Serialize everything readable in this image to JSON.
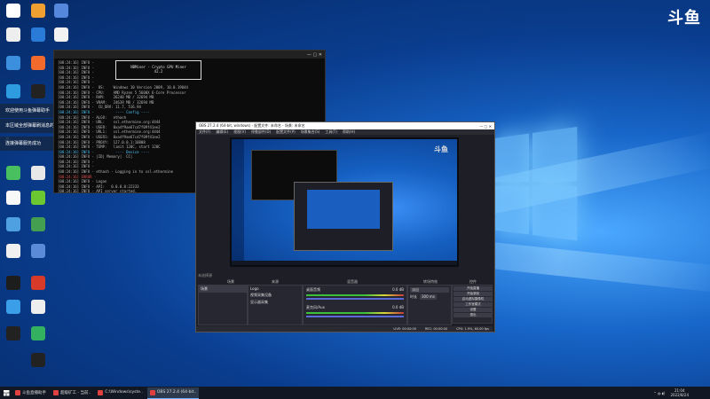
{
  "brand_logo": "斗鱼",
  "desktop_icons": [
    {
      "label": "",
      "color": "#ffffff"
    },
    {
      "label": "",
      "color": "#f0a030"
    },
    {
      "label": "",
      "color": "#5588dd"
    },
    {
      "label": "",
      "color": "#eeeeee"
    },
    {
      "label": "",
      "color": "#2a7ad8"
    },
    {
      "label": "",
      "color": "#f2f2f2"
    },
    {
      "label": "",
      "color": "#3b8fdc"
    },
    {
      "label": "",
      "color": "#f26a2c"
    },
    {
      "label": "",
      "color": "#2e9ae0"
    },
    {
      "label": "",
      "color": "#222222"
    },
    {
      "label": "",
      "color": "#48c060"
    },
    {
      "label": "",
      "color": "#e8e8e8"
    },
    {
      "label": "",
      "color": "#f8f8f8"
    },
    {
      "label": "",
      "color": "#6bc830"
    },
    {
      "label": "",
      "color": "#4fa0e0"
    },
    {
      "label": "",
      "color": "#44a050"
    },
    {
      "label": "",
      "color": "#f0f0f0"
    },
    {
      "label": "",
      "color": "#5a8ad8"
    },
    {
      "label": "",
      "color": "#1d1d1d"
    },
    {
      "label": "",
      "color": "#d83a2a"
    },
    {
      "label": "",
      "color": "#3b9ee8"
    },
    {
      "label": "",
      "color": "#eeeeee"
    },
    {
      "label": "",
      "color": "#222222"
    },
    {
      "label": "",
      "color": "#33b060"
    },
    {
      "label": "",
      "color": "#222222"
    }
  ],
  "toasts": [
    "欢迎使用斗鱼弹幕助手",
    "本区域全部弹幕刷消息的消息",
    "连接弹幕服务成功"
  ],
  "console": {
    "title": "",
    "banner_line1": "NBMiner - Crypto GPU Miner",
    "banner_line2": "42.2",
    "lines": [
      "[08:24:16] INFO - ",
      "[08:24:16] INFO - ",
      "[08:24:16] INFO - ",
      "[08:24:16] INFO - ",
      "[08:24:16] INFO - ",
      "[08:24:16] INFO -  OS:    Windows 10 Version 2009, 10.0.19044",
      "[08:24:16] INFO - CPU:    AMD Ryzen 5 5600X 6-Core Processor",
      "[08:24:16] INFO - RAM:    26240 MB / 32694 MB",
      "[08:24:16] INFO - VRAM:   24639 MB / 32694 MB",
      "[08:24:16] INFO -  CU_DRV: 11.7, 516.94",
      "[08:24:16] INFO -          ---- Config ----",
      "[08:24:16] INFO - ALGO:   ethash",
      "[08:24:16] INFO - URL:    ssl.ethermine.org:4444",
      "[08:24:16] INFO - USER:   0xa4f9ae67cd7f09f41ee2",
      "[08:24:16] INFO - URL1:   ssl.ethermine.org:4444",
      "[08:24:16] INFO - USER1:  0xa4f9ae67cd7f09f41ee2",
      "[08:24:16] INFO - PROXY:  127.0.0.1:10808",
      "[08:24:16] INFO - TEMP:   limit 120C, start 120C",
      "[08:24:16] INFO -          ---- Device ----",
      "[08:24:16] INFO - |ID| Memory|  CC| ",
      "[08:24:16] INFO - ",
      "[08:24:16] INFO - ",
      "[08:24:16] INFO - ethash - Logging in to ssl.ethermine",
      "[08:24:16] ERROR -",
      "[08:24:16] INFO - Logon",
      "[08:24:16] INFO - API:   0.0.0.0:22333",
      "[08:24:16] INFO - API server started."
    ]
  },
  "obs": {
    "title": "OBS 27.2.4 (64-bit, windows) - 配置文件: 未命名 - 场景: 未命名",
    "menu": [
      "文件(F)",
      "编辑(E)",
      "视图(V)",
      "停靠部件(D)",
      "配置文件(P)",
      "场景集合(S)",
      "工具(T)",
      "帮助(H)"
    ],
    "sections": {
      "scenes": "场景",
      "sources": "来源",
      "mixer": "混音器",
      "transitions": "转场特效",
      "controls": "控件"
    },
    "scene_list": [
      "场景"
    ],
    "sources": [
      "Logo",
      "视频采集设备",
      "显示器采集"
    ],
    "mixer": [
      {
        "name": "桌面音频",
        "db": "0.0 dB"
      },
      {
        "name": "麦克风/Aux",
        "db": "0.0 dB"
      }
    ],
    "transition": {
      "type": "淡出",
      "duration_label": "时长",
      "duration": "300 ms"
    },
    "controls": [
      "开始直播",
      "开始录制",
      "启动虚拟摄像机",
      "工作室模式",
      "设置",
      "退出"
    ],
    "status": {
      "live": "LIVE: 00:00:00",
      "rec": "REC: 00:00:00",
      "cpu": "CPU: 1.9%, 60.00 fps"
    },
    "none_selected": "未选择源"
  },
  "taskbar": {
    "items": [
      {
        "label": "斗鱼直播助手",
        "active": false
      },
      {
        "label": "超级矿工 - 当前..",
        "active": false
      },
      {
        "label": "C:\\Windows\\syste..",
        "active": false
      },
      {
        "label": "OBS 27.2.4 (64-bit..",
        "active": true
      }
    ],
    "time": "21:04",
    "date": "2022/8/24"
  }
}
